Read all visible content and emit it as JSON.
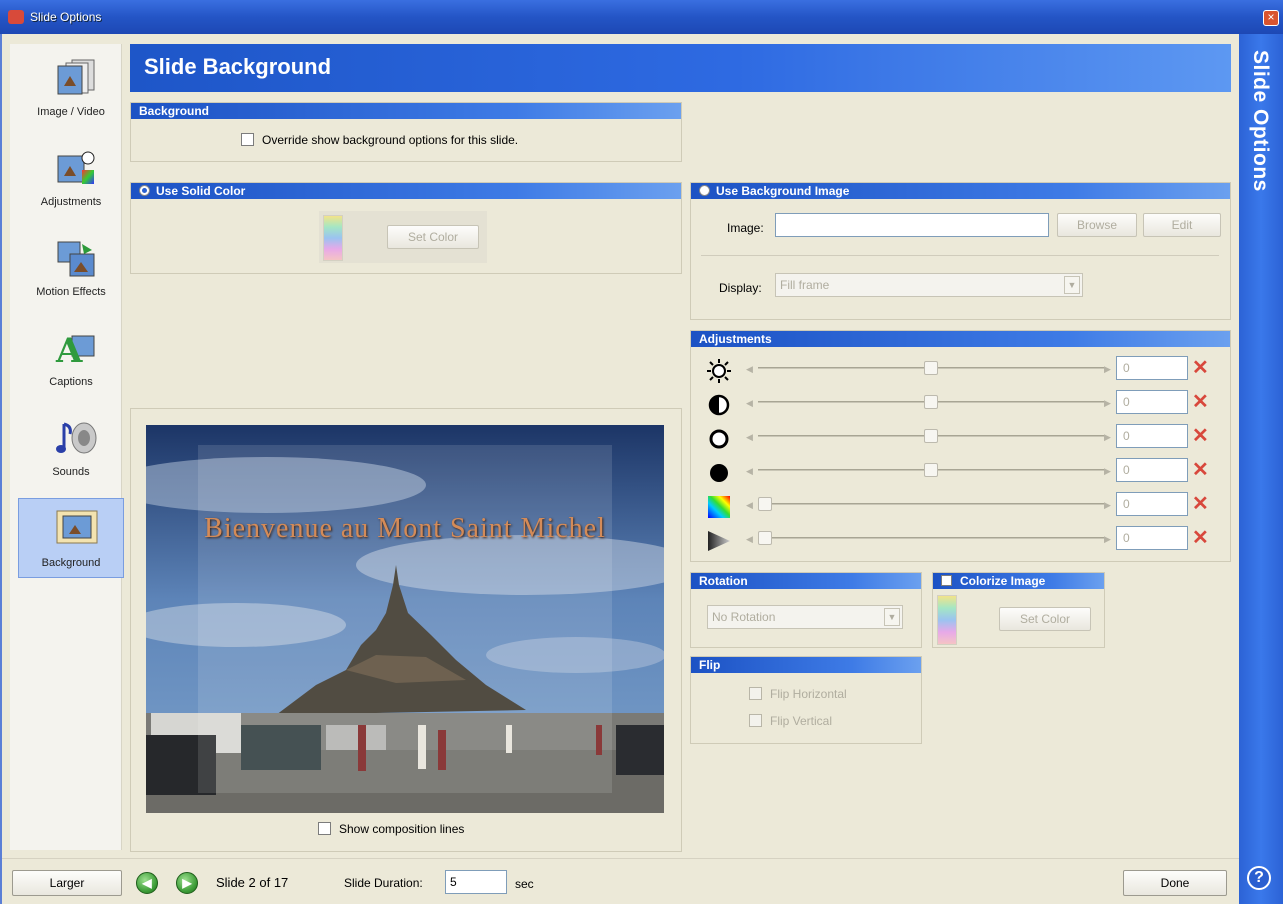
{
  "window": {
    "title": "Slide Options",
    "side_title": "Slide Options",
    "help_icon": "help-icon"
  },
  "nav": {
    "items": [
      {
        "label": "Image / Video",
        "icon": "image-video-icon"
      },
      {
        "label": "Adjustments",
        "icon": "adjustments-icon"
      },
      {
        "label": "Motion Effects",
        "icon": "motion-effects-icon"
      },
      {
        "label": "Captions",
        "icon": "captions-icon"
      },
      {
        "label": "Sounds",
        "icon": "sounds-icon"
      },
      {
        "label": "Background",
        "icon": "background-icon",
        "selected": true
      }
    ]
  },
  "header": {
    "title": "Slide Background"
  },
  "background": {
    "title": "Background",
    "override_label": "Override show background options for this slide."
  },
  "solid": {
    "title": "Use Solid Color",
    "set_color": "Set Color"
  },
  "bgimage": {
    "title": "Use Background Image",
    "image_label": "Image:",
    "image_value": "",
    "browse": "Browse",
    "edit": "Edit",
    "display_label": "Display:",
    "display_value": "Fill frame"
  },
  "adjustments": {
    "title": "Adjustments",
    "rows": [
      {
        "icon": "brightness-icon",
        "value": "0",
        "level": 0.5
      },
      {
        "icon": "contrast-icon",
        "value": "0",
        "level": 0.5
      },
      {
        "icon": "white-point-icon",
        "value": "0",
        "level": 0.5
      },
      {
        "icon": "black-point-icon",
        "value": "0",
        "level": 0.5
      },
      {
        "icon": "hue-icon",
        "value": "0",
        "level": 0
      },
      {
        "icon": "transparency-icon",
        "value": "0",
        "level": 0
      }
    ]
  },
  "rotation": {
    "title": "Rotation",
    "value": "No Rotation"
  },
  "colorize": {
    "title": "Colorize Image",
    "set_color": "Set Color"
  },
  "flip": {
    "title": "Flip",
    "horizontal": "Flip Horizontal",
    "vertical": "Flip Vertical"
  },
  "preview": {
    "caption": "Bienvenue au Mont Saint Michel",
    "show_lines": "Show composition lines"
  },
  "status": {
    "larger": "Larger",
    "slide_info": "Slide 2 of 17",
    "duration_label": "Slide Duration:",
    "duration_value": "5",
    "duration_unit": "sec",
    "done": "Done"
  }
}
